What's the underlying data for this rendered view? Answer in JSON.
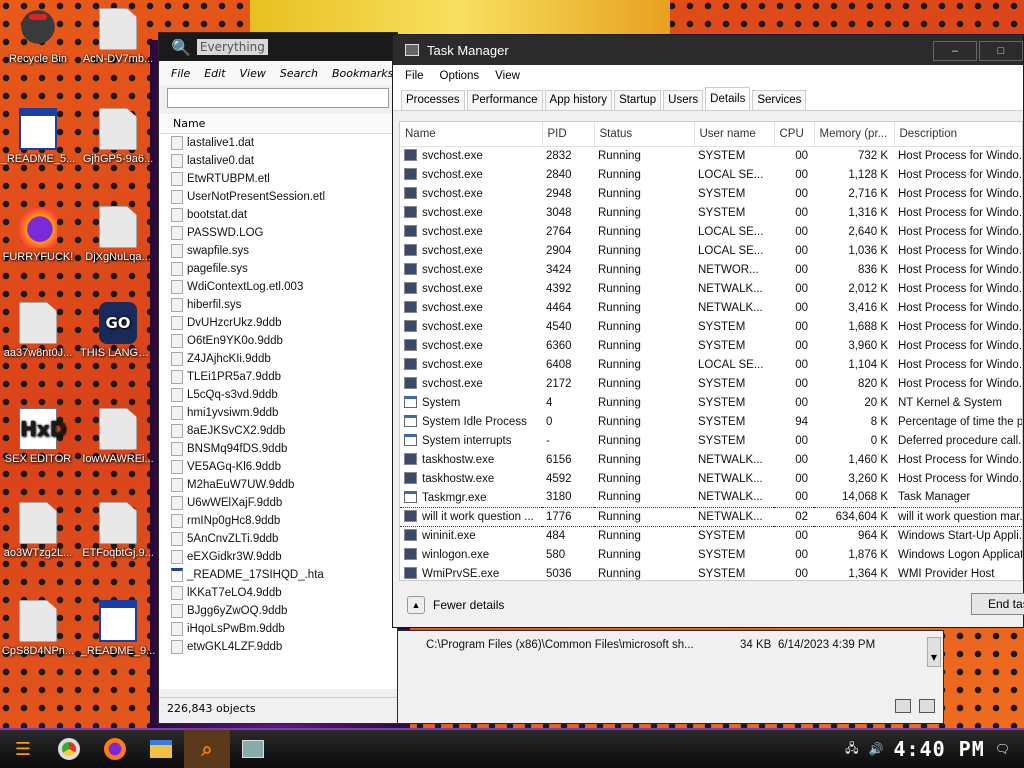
{
  "desktop": {
    "icons": [
      {
        "label": "Recycle Bin"
      },
      {
        "label": "AcN-DV7mb..."
      },
      {
        "label": "_README_5..."
      },
      {
        "label": "GjhGP5-9a6..."
      },
      {
        "label": "FURRYFUCK!"
      },
      {
        "label": "DjXgNuLqa..."
      },
      {
        "label": "aa37w8nt0J..."
      },
      {
        "label": "THIS LANGUAGE ..."
      },
      {
        "label": "SEX EDITOR"
      },
      {
        "label": "IowWAWREi..."
      },
      {
        "label": "ao3WTzg2L..."
      },
      {
        "label": "ETFoqbtGj.9..."
      },
      {
        "label": "CpS8D4NPn..."
      },
      {
        "label": "_README_9..."
      }
    ],
    "go_text": "GO",
    "hex_text": "HxD"
  },
  "everything": {
    "title": "Everything",
    "menu": [
      "File",
      "Edit",
      "View",
      "Search",
      "Bookmarks"
    ],
    "column_name": "Name",
    "files": [
      "lastalive1.dat",
      "lastalive0.dat",
      "EtwRTUBPM.etl",
      "UserNotPresentSession.etl",
      "bootstat.dat",
      "PASSWD.LOG",
      "swapfile.sys",
      "pagefile.sys",
      "WdiContextLog.etl.003",
      "hiberfil.sys",
      "DvUHzcrUkz.9ddb",
      "O6tEn9YK0o.9ddb",
      "Z4JAjhcKIi.9ddb",
      "TLEi1PR5a7.9ddb",
      "L5cQq-s3vd.9ddb",
      "hmi1yvsiwm.9ddb",
      "8aEJKSvCX2.9ddb",
      "BNSMq94fDS.9ddb",
      "VE5AGq-Kl6.9ddb",
      "M2haEuW7UW.9ddb",
      "U6wWElXajF.9ddb",
      "rmINp0gHc8.9ddb",
      "5AnCnvZLTi.9ddb",
      "eEXGidkr3W.9ddb",
      "_README_17SIHQD_.hta",
      "lKKaT7eLO4.9ddb",
      "BJgg6yZwOQ.9ddb",
      "iHqoLsPwBm.9ddb",
      "etwGKL4LZF.9ddb"
    ],
    "extra_rows": [
      {
        "path": "C:\\Program Files (x86)\\Common Files\\microsoft sh...",
        "size": "34 KB",
        "date": "6/14/2023 4:39 PM"
      }
    ],
    "status": "226,843 objects"
  },
  "taskmanager": {
    "title": "Task Manager",
    "controls": [
      "–",
      "□"
    ],
    "menu": [
      "File",
      "Options",
      "View"
    ],
    "tabs": [
      "Processes",
      "Performance",
      "App history",
      "Startup",
      "Users",
      "Details",
      "Services"
    ],
    "active_tab": "Details",
    "columns": [
      "Name",
      "PID",
      "Status",
      "User name",
      "CPU",
      "Memory (pr...",
      "Description"
    ],
    "rows": [
      {
        "name": "svchost.exe",
        "pid": "2832",
        "status": "Running",
        "user": "SYSTEM",
        "cpu": "00",
        "mem": "732 K",
        "desc": "Host Process for Windo..."
      },
      {
        "name": "svchost.exe",
        "pid": "2840",
        "status": "Running",
        "user": "LOCAL SE...",
        "cpu": "00",
        "mem": "1,128 K",
        "desc": "Host Process for Windo..."
      },
      {
        "name": "svchost.exe",
        "pid": "2948",
        "status": "Running",
        "user": "SYSTEM",
        "cpu": "00",
        "mem": "2,716 K",
        "desc": "Host Process for Windo..."
      },
      {
        "name": "svchost.exe",
        "pid": "3048",
        "status": "Running",
        "user": "SYSTEM",
        "cpu": "00",
        "mem": "1,316 K",
        "desc": "Host Process for Windo..."
      },
      {
        "name": "svchost.exe",
        "pid": "2764",
        "status": "Running",
        "user": "LOCAL SE...",
        "cpu": "00",
        "mem": "2,640 K",
        "desc": "Host Process for Windo..."
      },
      {
        "name": "svchost.exe",
        "pid": "2904",
        "status": "Running",
        "user": "LOCAL SE...",
        "cpu": "00",
        "mem": "1,036 K",
        "desc": "Host Process for Windo..."
      },
      {
        "name": "svchost.exe",
        "pid": "3424",
        "status": "Running",
        "user": "NETWOR...",
        "cpu": "00",
        "mem": "836 K",
        "desc": "Host Process for Windo..."
      },
      {
        "name": "svchost.exe",
        "pid": "4392",
        "status": "Running",
        "user": "NETWALK...",
        "cpu": "00",
        "mem": "2,012 K",
        "desc": "Host Process for Windo..."
      },
      {
        "name": "svchost.exe",
        "pid": "4464",
        "status": "Running",
        "user": "NETWALK...",
        "cpu": "00",
        "mem": "3,416 K",
        "desc": "Host Process for Windo..."
      },
      {
        "name": "svchost.exe",
        "pid": "4540",
        "status": "Running",
        "user": "SYSTEM",
        "cpu": "00",
        "mem": "1,688 K",
        "desc": "Host Process for Windo..."
      },
      {
        "name": "svchost.exe",
        "pid": "6360",
        "status": "Running",
        "user": "SYSTEM",
        "cpu": "00",
        "mem": "3,960 K",
        "desc": "Host Process for Windo..."
      },
      {
        "name": "svchost.exe",
        "pid": "6408",
        "status": "Running",
        "user": "LOCAL SE...",
        "cpu": "00",
        "mem": "1,104 K",
        "desc": "Host Process for Windo..."
      },
      {
        "name": "svchost.exe",
        "pid": "2172",
        "status": "Running",
        "user": "SYSTEM",
        "cpu": "00",
        "mem": "820 K",
        "desc": "Host Process for Windo..."
      },
      {
        "name": "System",
        "pid": "4",
        "status": "Running",
        "user": "SYSTEM",
        "cpu": "00",
        "mem": "20 K",
        "desc": "NT Kernel & System"
      },
      {
        "name": "System Idle Process",
        "pid": "0",
        "status": "Running",
        "user": "SYSTEM",
        "cpu": "94",
        "mem": "8 K",
        "desc": "Percentage of time the p..."
      },
      {
        "name": "System interrupts",
        "pid": "-",
        "status": "Running",
        "user": "SYSTEM",
        "cpu": "00",
        "mem": "0 K",
        "desc": "Deferred procedure call..."
      },
      {
        "name": "taskhostw.exe",
        "pid": "6156",
        "status": "Running",
        "user": "NETWALK...",
        "cpu": "00",
        "mem": "1,460 K",
        "desc": "Host Process for Windo..."
      },
      {
        "name": "taskhostw.exe",
        "pid": "4592",
        "status": "Running",
        "user": "NETWALK...",
        "cpu": "00",
        "mem": "3,260 K",
        "desc": "Host Process for Windo..."
      },
      {
        "name": "Taskmgr.exe",
        "pid": "3180",
        "status": "Running",
        "user": "NETWALK...",
        "cpu": "00",
        "mem": "14,068 K",
        "desc": "Task Manager"
      },
      {
        "name": "will it work question ...",
        "pid": "1776",
        "status": "Running",
        "user": "NETWALK...",
        "cpu": "02",
        "mem": "634,604 K",
        "desc": "will it work question mar..."
      },
      {
        "name": "wininit.exe",
        "pid": "484",
        "status": "Running",
        "user": "SYSTEM",
        "cpu": "00",
        "mem": "964 K",
        "desc": "Windows Start-Up Appli..."
      },
      {
        "name": "winlogon.exe",
        "pid": "580",
        "status": "Running",
        "user": "SYSTEM",
        "cpu": "00",
        "mem": "1,876 K",
        "desc": "Windows Logon Applicat..."
      },
      {
        "name": "WmiPrvSE.exe",
        "pid": "5036",
        "status": "Running",
        "user": "SYSTEM",
        "cpu": "00",
        "mem": "1,364 K",
        "desc": "WMI Provider Host"
      }
    ],
    "fewer_details": "Fewer details",
    "end_task": "End task"
  },
  "taskbar": {
    "clock": "4:40 PM"
  }
}
